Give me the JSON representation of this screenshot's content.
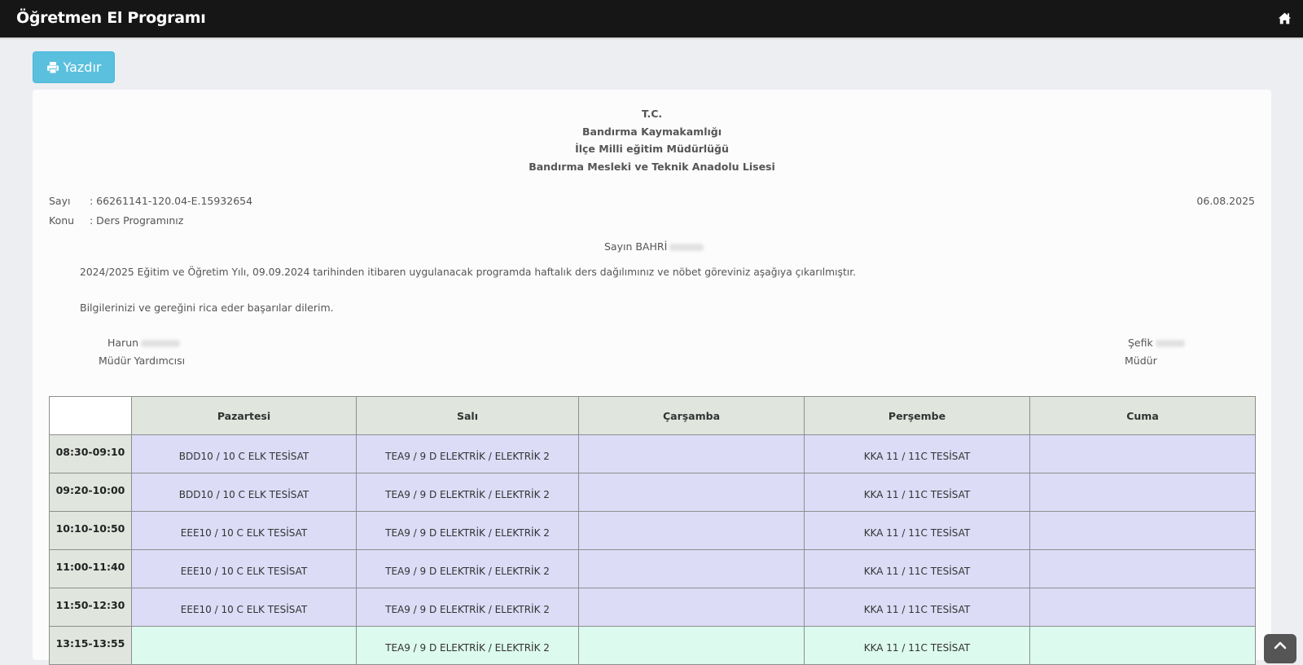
{
  "app": {
    "title": "Öğretmen El Programı",
    "home_icon": "home-icon"
  },
  "toolbar": {
    "print_label": "Yazdır",
    "print_icon": "print-icon",
    "print_color": "#5bc0de"
  },
  "letter": {
    "heading": [
      "T.C.",
      "Bandırma Kaymakamlığı",
      "İlçe Milli eğitim Müdürlüğü",
      "Bandırma Mesleki ve Teknik Anadolu Lisesi"
    ],
    "sayi_label": "Sayı",
    "sayi_value": ": 66261141-120.04-E.15932654",
    "konu_label": "Konu",
    "konu_value": ": Ders Programınız",
    "date": "06.08.2025",
    "salutation": "Sayın BAHRİ",
    "body_1": "2024/2025 Eğitim ve Öğretim Yılı, 09.09.2024 tarihinden itibaren uygulanacak programda haftalık ders dağılımınız ve nöbet göreviniz aşağıya çıkarılmıştır.",
    "body_2": "Bilgilerinizi ve gereğini rica eder başarılar dilerim.",
    "signer_left_name": "Harun",
    "signer_left_title": "Müdür Yardımcısı",
    "signer_right_name": "Şefik",
    "signer_right_title": "Müdür"
  },
  "schedule": {
    "days": [
      "Pazartesi",
      "Salı",
      "Çarşamba",
      "Perşembe",
      "Cuma"
    ],
    "rows": [
      {
        "time": "08:30-09:10",
        "cells": [
          "BDD10 / 10 C ELK TESİSAT",
          "TEA9 / 9 D ELEKTRİK / ELEKTRİK 2",
          "",
          "KKA 11 / 11C TESİSAT",
          ""
        ]
      },
      {
        "time": "09:20-10:00",
        "cells": [
          "BDD10 / 10 C ELK TESİSAT",
          "TEA9 / 9 D ELEKTRİK / ELEKTRİK 2",
          "",
          "KKA 11 / 11C TESİSAT",
          ""
        ]
      },
      {
        "time": "10:10-10:50",
        "cells": [
          "EEE10 / 10 C ELK TESİSAT",
          "TEA9 / 9 D ELEKTRİK / ELEKTRİK 2",
          "",
          "KKA 11 / 11C TESİSAT",
          ""
        ]
      },
      {
        "time": "11:00-11:40",
        "cells": [
          "EEE10 / 10 C ELK TESİSAT",
          "TEA9 / 9 D ELEKTRİK / ELEKTRİK 2",
          "",
          "KKA 11 / 11C TESİSAT",
          ""
        ]
      },
      {
        "time": "11:50-12:30",
        "cells": [
          "EEE10 / 10 C ELK TESİSAT",
          "TEA9 / 9 D ELEKTRİK / ELEKTRİK 2",
          "",
          "KKA 11 / 11C TESİSAT",
          ""
        ]
      },
      {
        "time": "13:15-13:55",
        "cells": [
          "",
          "TEA9 / 9 D ELEKTRİK / ELEKTRİK 2",
          "",
          "KKA 11 / 11C TESİSAT",
          ""
        ]
      }
    ]
  },
  "colors": {
    "morning": "#dcdcf7",
    "afternoon": "#dcfaee",
    "header": "#e0e6de",
    "navbar": "#161616"
  },
  "scroll_top_icon": "chevron-up-icon"
}
